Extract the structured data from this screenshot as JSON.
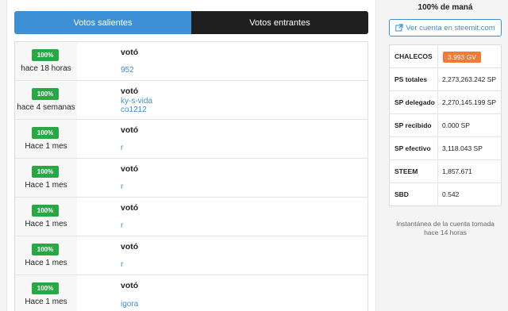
{
  "tabs": [
    {
      "label": "Votos salientes",
      "active": true
    },
    {
      "label": "Votos entrantes",
      "active": false
    }
  ],
  "votes": [
    {
      "percent": "100%",
      "time": "hace 18 horas",
      "action": "votó",
      "links": [
        "952"
      ]
    },
    {
      "percent": "100%",
      "time": "hace 4 semanas",
      "action": "votó",
      "links": [
        "ky-s-vida",
        "co1212"
      ]
    },
    {
      "percent": "100%",
      "time": "Hace 1 mes",
      "action": "votó",
      "links": [
        "r"
      ]
    },
    {
      "percent": "100%",
      "time": "Hace 1 mes",
      "action": "votó",
      "links": [
        "r"
      ]
    },
    {
      "percent": "100%",
      "time": "Hace 1 mes",
      "action": "votó",
      "links": [
        "r"
      ]
    },
    {
      "percent": "100%",
      "time": "Hace 1 mes",
      "action": "votó",
      "links": [
        "r"
      ]
    },
    {
      "percent": "100%",
      "time": "Hace 1 mes",
      "action": "votó",
      "links": [
        "igora"
      ]
    }
  ],
  "sidebar": {
    "mana": "100% de maná",
    "steemit_button": "Ver cuenta en steemit.com",
    "stats": [
      {
        "key": "CHALECOS",
        "value": "3.993 GV",
        "badge": true
      },
      {
        "key": "PS totales",
        "value": "2,273,263.242 SP"
      },
      {
        "key": "SP delegado",
        "value": "2,270,145.199 SP"
      },
      {
        "key": "SP recibido",
        "value": "0.000 SP"
      },
      {
        "key": "SP efectivo",
        "value": "3,118.043 SP"
      },
      {
        "key": "STEEM",
        "value": "1,857.671"
      },
      {
        "key": "SBD",
        "value": "0.542"
      }
    ],
    "snapshot": "Instantánea de la cuenta tomada hace 14 horas"
  },
  "colors": {
    "accent": "#3d8fd6",
    "badge_green": "#28a745",
    "badge_orange": "#f07a36",
    "tab_dark": "#1f1f1f"
  }
}
